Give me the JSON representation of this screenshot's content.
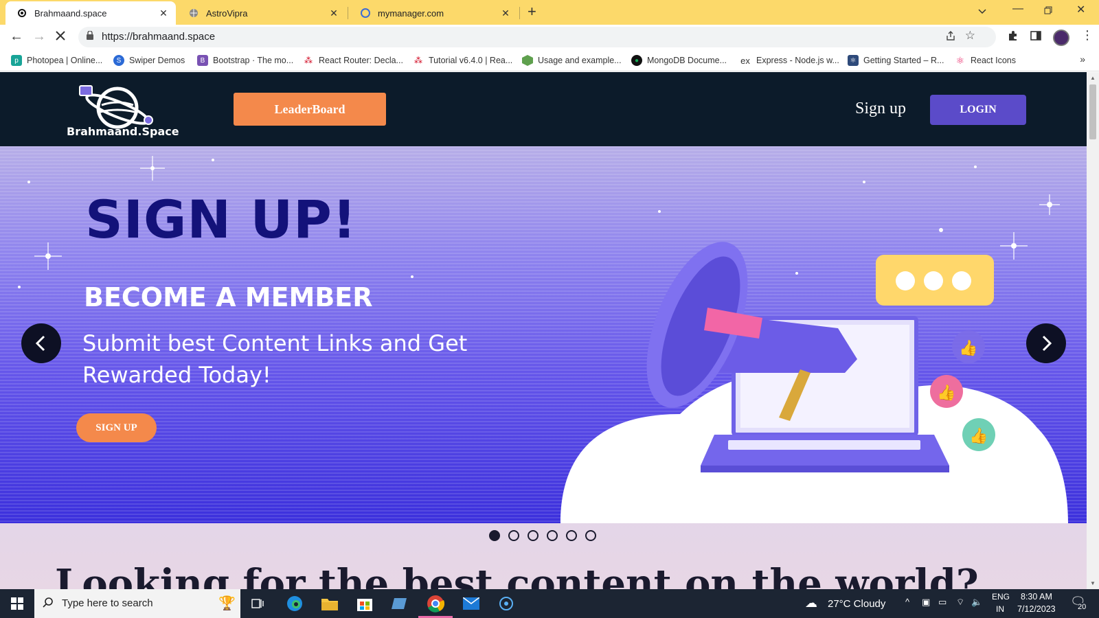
{
  "browser": {
    "tabs": [
      {
        "title": "Brahmaand.space",
        "active": true
      },
      {
        "title": "AstroVipra",
        "active": false
      },
      {
        "title": "mymanager.com",
        "active": false
      }
    ],
    "url": "https://brahmaand.space",
    "bookmarks": [
      {
        "label": "Photopea | Online...",
        "color": "#18a497"
      },
      {
        "label": "Swiper Demos",
        "color": "#2b6ad6"
      },
      {
        "label": "Bootstrap · The mo...",
        "color": "#7952b3"
      },
      {
        "label": "React Router: Decla...",
        "color": "#d0021b"
      },
      {
        "label": "Tutorial v6.4.0 | Rea...",
        "color": "#d0021b"
      },
      {
        "label": "Usage and example...",
        "color": "#5fa04e"
      },
      {
        "label": "MongoDB Docume...",
        "color": "#13aa52"
      },
      {
        "label": "Express - Node.js w...",
        "color": "#333333"
      },
      {
        "label": "Getting Started – R...",
        "color": "#2e4a7a"
      },
      {
        "label": "React Icons",
        "color": "#e91e63"
      }
    ]
  },
  "site": {
    "logo_text": "Brahmaand.Space",
    "leaderboard_label": "LeaderBoard",
    "signup_link": "Sign up",
    "login_label": "LOGIN"
  },
  "hero": {
    "title": "SIGN UP!",
    "subtitle": "BECOME A MEMBER",
    "description": "Submit best Content Links and Get Rewarded Today!",
    "cta_label": "SIGN UP",
    "slide_count": 6,
    "active_slide": 1
  },
  "next_section_heading": "Looking for the best content on the world?",
  "taskbar": {
    "search_placeholder": "Type here to search",
    "weather": "27°C  Cloudy",
    "lang": "ENG",
    "region": "IN",
    "time": "8:30 AM",
    "date": "7/12/2023",
    "notifications": "20"
  },
  "colors": {
    "accent_orange": "#f4894b",
    "login_purple": "#5b4bc9",
    "header_navy": "#0c1b2a",
    "tabstrip_yellow": "#fcd96a"
  }
}
